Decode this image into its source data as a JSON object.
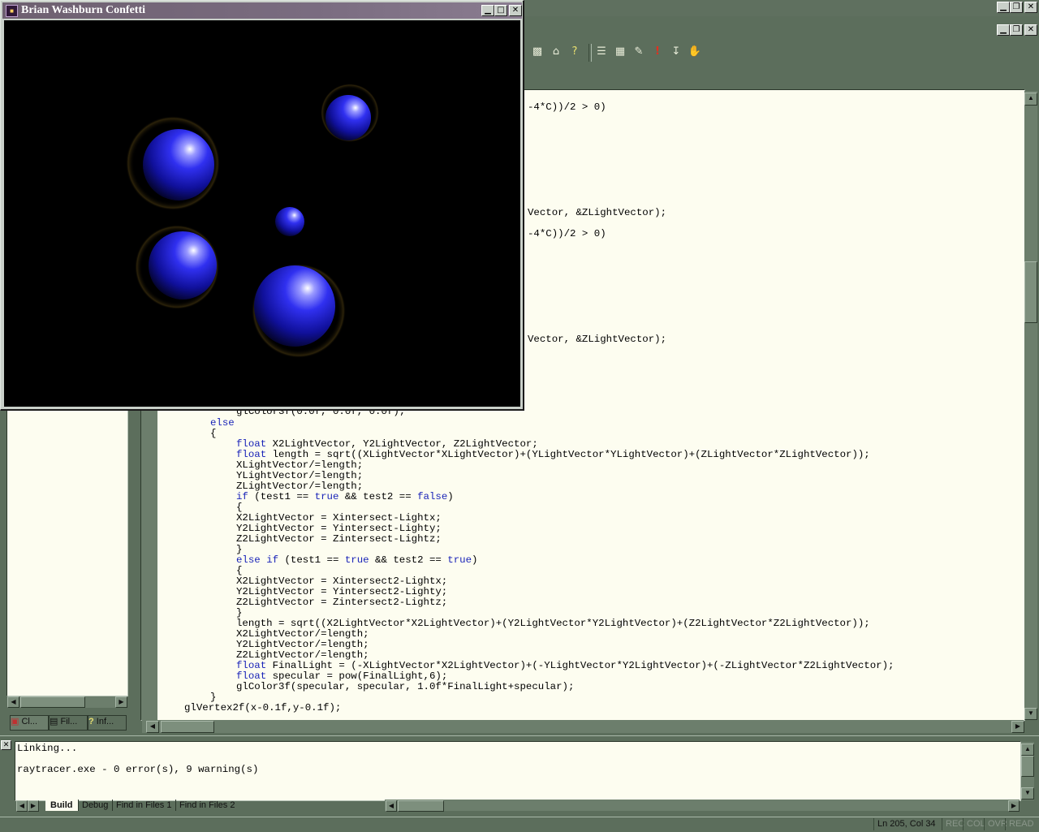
{
  "app_window": {
    "code_fragments": [
      "-4*C))/2 > 0)",
      "Vector, &ZLightVector);",
      "-4*C))/2 > 0)",
      "Vector, &ZLightVector);"
    ],
    "code_top_partial": "glColor3f(0.0f, 0.0f, 0.0f);",
    "code_lines": [
      [
        {
          "t": "else",
          "k": 1
        }
      ],
      [
        {
          "t": "{"
        }
      ],
      [
        {
          "t": "float",
          "k": 1
        },
        {
          "t": " X2LightVector, Y2LightVector, Z2LightVector;"
        }
      ],
      [
        {
          "t": "float",
          "k": 1
        },
        {
          "t": " length = sqrt((XLightVector*XLightVector)+(YLightVector*YLightVector)+(ZLightVector*ZLightVector));"
        }
      ],
      [
        {
          "t": "XLightVector/=length;"
        }
      ],
      [
        {
          "t": "YLightVector/=length;"
        }
      ],
      [
        {
          "t": "ZLightVector/=length;"
        }
      ],
      [
        {
          "t": "if",
          "k": 1
        },
        {
          "t": " (test1 == "
        },
        {
          "t": "true",
          "k": 1
        },
        {
          "t": " && test2 == "
        },
        {
          "t": "false",
          "k": 1
        },
        {
          "t": ")"
        }
      ],
      [
        {
          "t": "{"
        }
      ],
      [
        {
          "t": "X2LightVector = Xintersect-Lightx;"
        }
      ],
      [
        {
          "t": "Y2LightVector = Yintersect-Lighty;"
        }
      ],
      [
        {
          "t": "Z2LightVector = Zintersect-Lightz;"
        }
      ],
      [
        {
          "t": "}"
        }
      ],
      [
        {
          "t": "else",
          "k": 1
        },
        {
          "t": " "
        },
        {
          "t": "if",
          "k": 1
        },
        {
          "t": " (test1 == "
        },
        {
          "t": "true",
          "k": 1
        },
        {
          "t": " && test2 == "
        },
        {
          "t": "true",
          "k": 1
        },
        {
          "t": ")"
        }
      ],
      [
        {
          "t": "{"
        }
      ],
      [
        {
          "t": "X2LightVector = Xintersect2-Lightx;"
        }
      ],
      [
        {
          "t": "Y2LightVector = Yintersect2-Lighty;"
        }
      ],
      [
        {
          "t": "Z2LightVector = Zintersect2-Lightz;"
        }
      ],
      [
        {
          "t": "}"
        }
      ],
      [
        {
          "t": "length = sqrt((X2LightVector*X2LightVector)+(Y2LightVector*Y2LightVector)+(Z2LightVector*Z2LightVector));"
        }
      ],
      [
        {
          "t": "X2LightVector/=length;"
        }
      ],
      [
        {
          "t": "Y2LightVector/=length;"
        }
      ],
      [
        {
          "t": "Z2LightVector/=length;"
        }
      ],
      [
        {
          "t": "float",
          "k": 1
        },
        {
          "t": " FinalLight = (-XLightVector*X2LightVector)+(-YLightVector*Y2LightVector)+(-ZLightVector*Z2LightVector);"
        }
      ],
      [
        {
          "t": "float",
          "k": 1
        },
        {
          "t": " specular = pow(FinalLight,6);"
        }
      ],
      [
        {
          "t": "glColor3f(specular, specular, 1.0f*FinalLight+specular);"
        }
      ],
      [
        {
          "t": "}"
        }
      ],
      [
        {
          "t": "glVertex2f(x-0.1f,y-0.1f);"
        }
      ]
    ]
  },
  "workspace_tabs": [
    {
      "label": "Cl...",
      "icon": "class-view-icon"
    },
    {
      "label": "Fil...",
      "icon": "file-view-icon"
    },
    {
      "label": "Inf...",
      "icon": "info-view-icon"
    }
  ],
  "output": {
    "lines": [
      "Linking...",
      "",
      "raytracer.exe - 0 error(s), 9 warning(s)"
    ],
    "tabs": [
      "Build",
      "Debug",
      "Find in Files 1",
      "Find in Files 2"
    ],
    "active_tab": "Build"
  },
  "statusbar": {
    "position": "Ln 205, Col 34",
    "indicators": [
      "REC",
      "COL",
      "OVR",
      "READ"
    ]
  },
  "confetti_window": {
    "title": "Brian Washburn Confetti"
  },
  "colors": {
    "desktop": "#5c6e5c",
    "editor_bg": "#fdfdf0",
    "keyword": "#1a24b8",
    "sphere": "#2a2aff",
    "title_bar": "#6e6070"
  }
}
